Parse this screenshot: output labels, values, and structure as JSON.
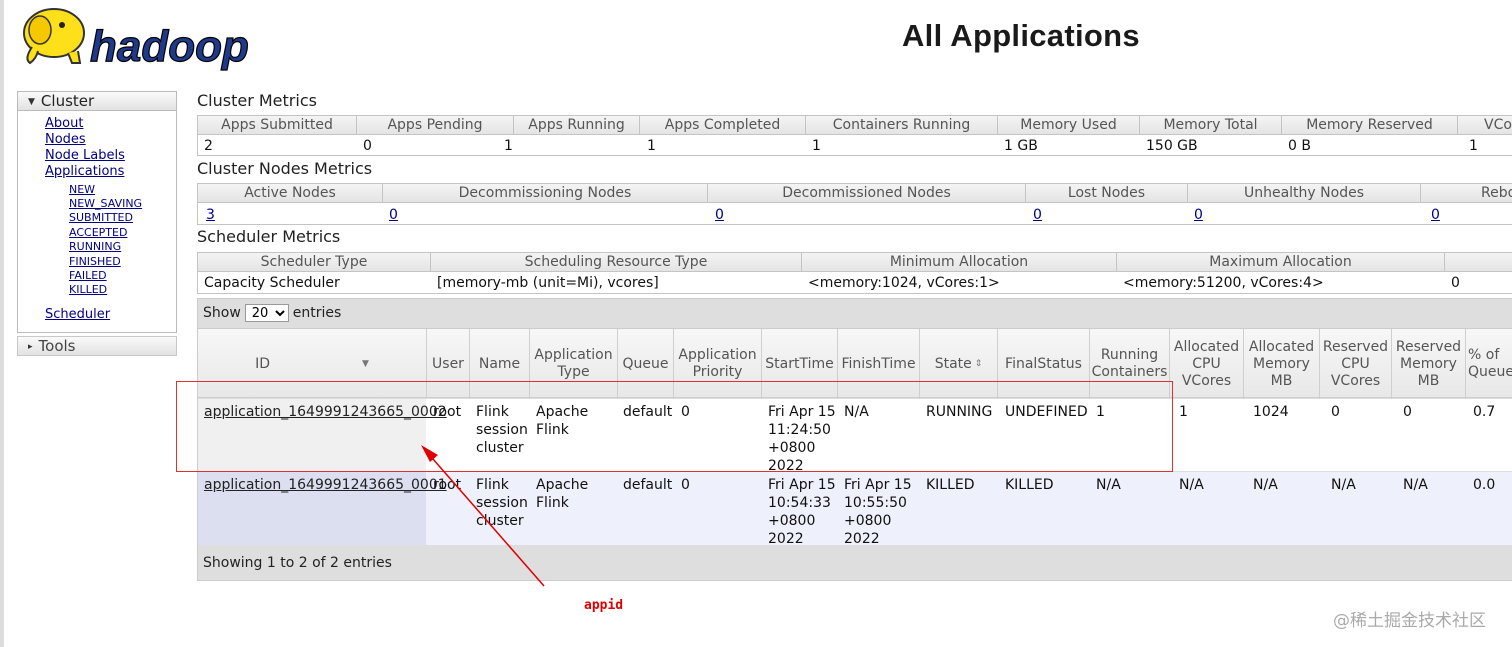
{
  "logo_text": "hadoop",
  "page_title": "All Applications",
  "sidebar": {
    "cluster_label": "Cluster",
    "links": [
      "About",
      "Nodes",
      "Node Labels",
      "Applications"
    ],
    "app_states": [
      "NEW",
      "NEW_SAVING",
      "SUBMITTED",
      "ACCEPTED",
      "RUNNING",
      "FINISHED",
      "FAILED",
      "KILLED"
    ],
    "scheduler": "Scheduler",
    "tools_label": "Tools"
  },
  "cluster_metrics": {
    "title": "Cluster Metrics",
    "headers": [
      "Apps Submitted",
      "Apps Pending",
      "Apps Running",
      "Apps Completed",
      "Containers Running",
      "Memory Used",
      "Memory Total",
      "Memory Reserved",
      "VCor"
    ],
    "values": [
      "2",
      "0",
      "1",
      "1",
      "1",
      "1 GB",
      "150 GB",
      "0 B",
      "1"
    ]
  },
  "cluster_nodes_metrics": {
    "title": "Cluster Nodes Metrics",
    "headers": [
      "Active Nodes",
      "Decommissioning Nodes",
      "Decommissioned Nodes",
      "Lost Nodes",
      "Unhealthy Nodes",
      "Rebo"
    ],
    "values": [
      "3",
      "0",
      "0",
      "0",
      "0",
      "0"
    ]
  },
  "scheduler_metrics": {
    "title": "Scheduler Metrics",
    "headers": [
      "Scheduler Type",
      "Scheduling Resource Type",
      "Minimum Allocation",
      "Maximum Allocation",
      ""
    ],
    "values": [
      "Capacity Scheduler",
      "[memory-mb (unit=Mi), vcores]",
      "<memory:1024, vCores:1>",
      "<memory:51200, vCores:4>",
      "0"
    ]
  },
  "apps_table": {
    "show_label": "Show",
    "entries_label": "entries",
    "page_size": "20",
    "columns": [
      "ID",
      "User",
      "Name",
      "Application Type",
      "Queue",
      "Application Priority",
      "StartTime",
      "FinishTime",
      "State",
      "FinalStatus",
      "Running Containers",
      "Allocated CPU VCores",
      "Allocated Memory MB",
      "Reserved CPU VCores",
      "Reserved Memory MB",
      "% of Queue"
    ],
    "rows": [
      {
        "id": "application_1649991243665_0002",
        "user": "root",
        "name": "Flink session cluster",
        "type": "Apache Flink",
        "queue": "default",
        "priority": "0",
        "start": "Fri Apr 15 11:24:50 +0800 2022",
        "finish": "N/A",
        "state": "RUNNING",
        "final_status": "UNDEFINED",
        "running_containers": "1",
        "alloc_vcores": "1",
        "alloc_mem": "1024",
        "res_vcores": "0",
        "res_mem": "0",
        "pct_queue": "0.7"
      },
      {
        "id": "application_1649991243665_0001",
        "user": "root",
        "name": "Flink session cluster",
        "type": "Apache Flink",
        "queue": "default",
        "priority": "0",
        "start": "Fri Apr 15 10:54:33 +0800 2022",
        "finish": "Fri Apr 15 10:55:50 +0800 2022",
        "state": "KILLED",
        "final_status": "KILLED",
        "running_containers": "N/A",
        "alloc_vcores": "N/A",
        "alloc_mem": "N/A",
        "res_vcores": "N/A",
        "res_mem": "N/A",
        "pct_queue": "0.0"
      }
    ],
    "footer": "Showing 1 to 2 of 2 entries"
  },
  "annotation": {
    "label": "appid",
    "color": "#e00000"
  },
  "watermark": "@稀土掘金技术社区"
}
